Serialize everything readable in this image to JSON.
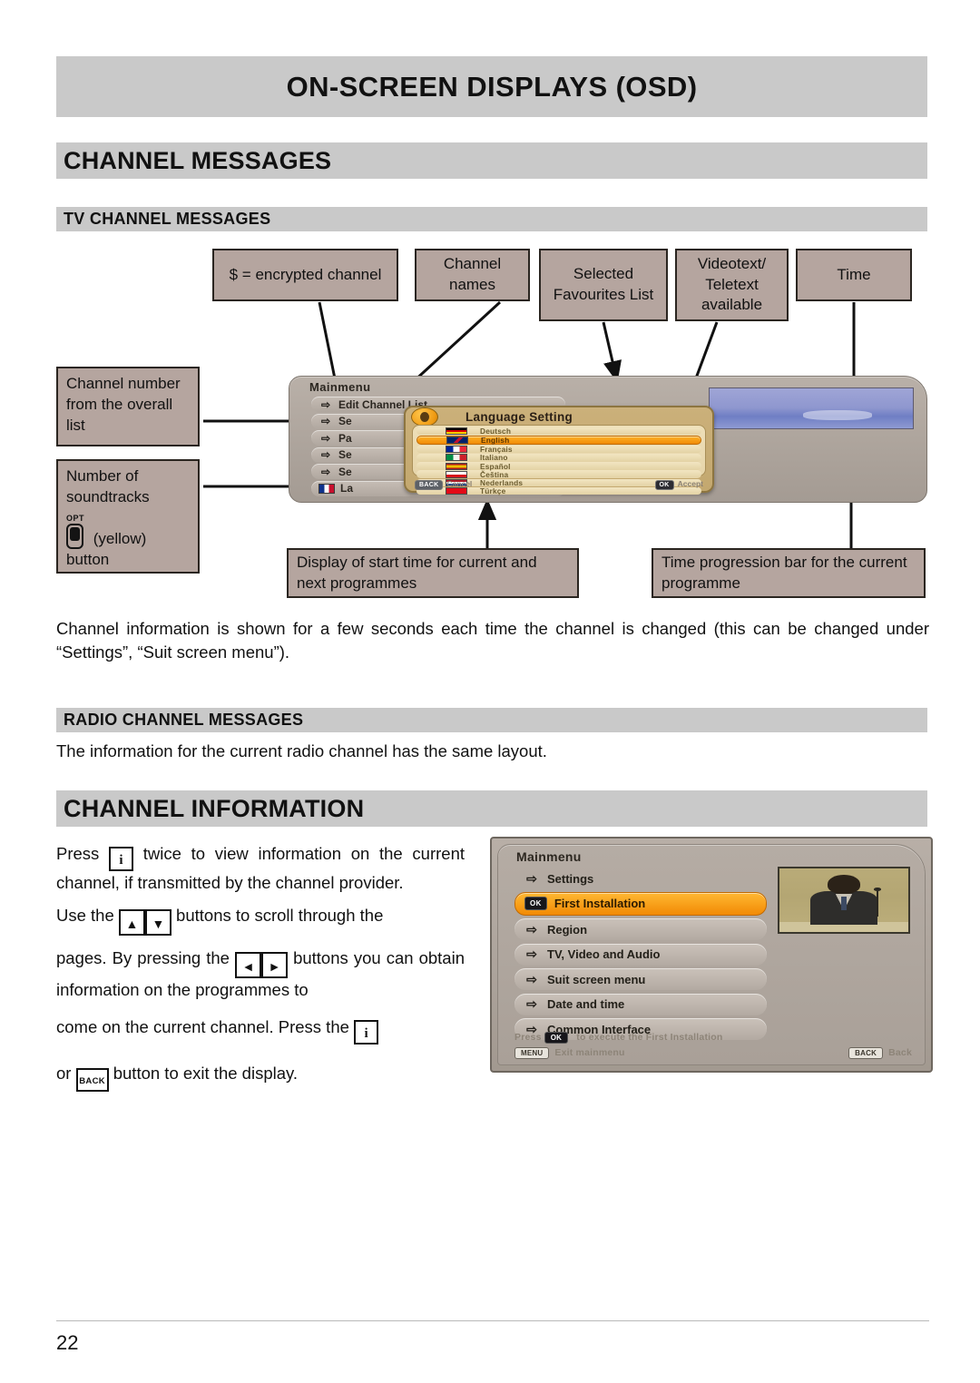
{
  "page": {
    "chapter_title": "ON-SCREEN DISPLAYS (OSD)",
    "page_number": "22"
  },
  "sections": {
    "channel_messages": "CHANNEL MESSAGES",
    "tv_channel_messages": "TV CHANNEL MESSAGES",
    "radio_channel_messages": "RADIO CHANNEL MESSAGES",
    "channel_information": "CHANNEL INFORMATION"
  },
  "callouts": {
    "encrypted": "$ = encrypted channel",
    "channel_names": "Channel names",
    "favourites": "Selected Favourites List",
    "videotext": "Videotext/ Teletext available",
    "time": "Time",
    "channel_number": "Channel number from the overall list",
    "soundtracks_line1": "Number of",
    "soundtracks_line2": "soundtracks",
    "soundtracks_opt_label": "OPT",
    "soundtracks_line3": "(yellow)",
    "soundtracks_line4": "button",
    "start_time": "Display of start time for current and next programmes",
    "progress_bar": "Time progression bar for the current programme"
  },
  "body": {
    "channel_messages_para": "Channel information is shown for a few seconds each time the channel is changed (this can be changed under “Settings”, “Suit screen menu”).",
    "radio_para": "The information for the current radio channel has the same layout.",
    "info_p1_a": "Press",
    "info_p1_b": "twice to view information on the current channel, if transmitted by the channel provider.",
    "info_p2_a": "Use the",
    "info_p2_b": "buttons to scroll through the",
    "info_p3_a": "pages. By pressing the",
    "info_p3_b": "buttons you can obtain information on the programmes to",
    "info_p4_a": "come on the current channel. Press the",
    "info_p5_a": "or",
    "info_p5_b": "button to exit the display."
  },
  "keys": {
    "info": "i",
    "up": "▲",
    "down": "▼",
    "left": "◄",
    "right": "►",
    "back": "BACK"
  },
  "osd_top": {
    "title": "Mainmenu",
    "menu_items": [
      {
        "label": "Edit Channel List",
        "icon": "loop-arrow-icon"
      },
      {
        "label": "Se",
        "icon": "loop-arrow-icon"
      },
      {
        "label": "Pa",
        "icon": "loop-arrow-icon"
      },
      {
        "label": "Se",
        "icon": "loop-arrow-icon"
      },
      {
        "label": "Se",
        "icon": "loop-arrow-icon"
      },
      {
        "label": "La",
        "icon": "flag-icon"
      }
    ],
    "dialog": {
      "title": "Language Setting",
      "icon": "globe-icon",
      "languages": [
        {
          "name": "Deutsch",
          "selected": false,
          "flag": [
            "#000000",
            "#dd0000",
            "#ffce00"
          ]
        },
        {
          "name": "English",
          "selected": true,
          "flag": [
            "#012169",
            "#ffffff",
            "#c8102e"
          ]
        },
        {
          "name": "Français",
          "selected": false,
          "flag": [
            "#002395",
            "#ffffff",
            "#ed2939"
          ]
        },
        {
          "name": "Italiano",
          "selected": false,
          "flag": [
            "#008c45",
            "#f4f5f0",
            "#cd212a"
          ]
        },
        {
          "name": "Español",
          "selected": false,
          "flag": [
            "#aa151b",
            "#f1bf00",
            "#aa151b"
          ]
        },
        {
          "name": "Čeština",
          "selected": false,
          "flag": [
            "#11457e",
            "#ffffff",
            "#d7141a"
          ]
        },
        {
          "name": "Nederlands",
          "selected": false,
          "flag": [
            "#ae1c28",
            "#ffffff",
            "#21468b"
          ]
        },
        {
          "name": "Türkçe",
          "selected": false,
          "flag": [
            "#e30a17",
            "#ffffff",
            "#e30a17"
          ]
        }
      ],
      "cancel_key": "BACK",
      "cancel_label": "Cancel",
      "accept_key": "OK",
      "accept_label": "Accept"
    }
  },
  "osd_bottom": {
    "title": "Mainmenu",
    "menu_items": [
      {
        "label": "Settings",
        "icon": "loop-arrow-icon",
        "selected": false,
        "plain": true
      },
      {
        "label": "First Installation",
        "icon": "ok-chip-icon",
        "selected": true,
        "plain": false
      },
      {
        "label": "Region",
        "icon": "loop-arrow-icon",
        "selected": false,
        "plain": false
      },
      {
        "label": "TV, Video and Audio",
        "icon": "loop-arrow-icon",
        "selected": false,
        "plain": false
      },
      {
        "label": "Suit screen menu",
        "icon": "loop-arrow-icon",
        "selected": false,
        "plain": false
      },
      {
        "label": "Date and time",
        "icon": "loop-arrow-icon",
        "selected": false,
        "plain": false
      },
      {
        "label": "Common Interface",
        "icon": "loop-arrow-icon",
        "selected": false,
        "plain": false
      }
    ],
    "hint_press": "Press",
    "hint_ok": "OK",
    "hint_press_rest": "to execute the First Installation",
    "hint_menu_key": "MENU",
    "hint_menu_label": "Exit mainmenu",
    "hint_back_key": "BACK",
    "hint_back_label": "Back"
  },
  "colors": {
    "band_gray": "#c9c9c9",
    "callout_fill": "#b5a59f",
    "highlight_orange": "#f28a04",
    "osd_body": "#ada49c"
  }
}
